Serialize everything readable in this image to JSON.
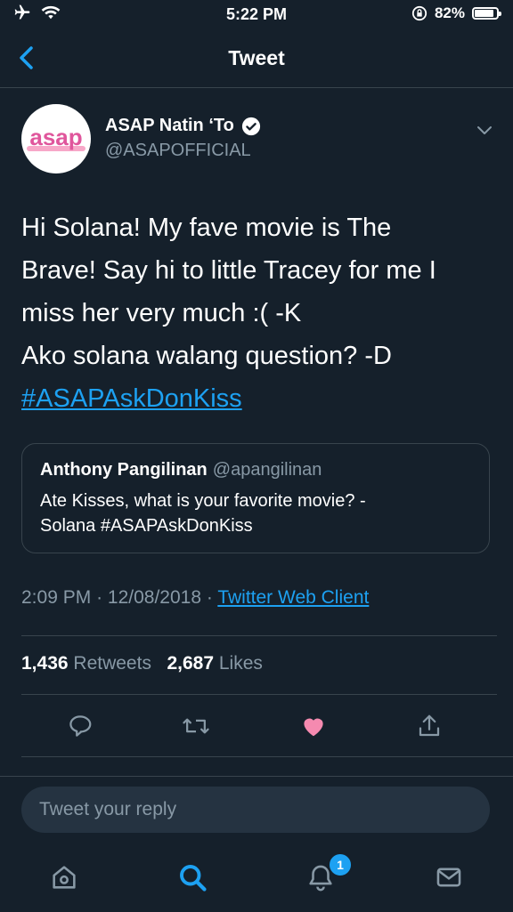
{
  "status_bar": {
    "time": "5:22 PM",
    "battery": "82%",
    "battery_level": 0.82
  },
  "nav": {
    "title": "Tweet"
  },
  "author": {
    "name": "ASAP Natin ‘To",
    "handle": "@ASAPOFFICIAL",
    "avatar_text": "asap"
  },
  "tweet": {
    "lines": [
      "Hi Solana! My fave movie is The",
      "Brave! Say hi to little Tracey for me I",
      "miss her very much :( -K",
      "Ako solana walang question? -D"
    ],
    "hashtag": "#ASAPAskDonKiss"
  },
  "quote": {
    "name": "Anthony Pangilinan",
    "handle": "@apangilinan",
    "lines": [
      "Ate Kisses, what is your favorite movie? -",
      "Solana #ASAPAskDonKiss"
    ]
  },
  "meta": {
    "time": "2:09 PM",
    "sep": "·",
    "date": "12/08/2018",
    "client": "Twitter Web Client"
  },
  "stats": {
    "retweets": "1,436",
    "retweets_label": "Retweets",
    "likes": "2,687",
    "likes_label": "Likes"
  },
  "reply": {
    "placeholder": "Tweet your reply"
  },
  "tabbar": {
    "notifications_badge": "1"
  },
  "colors": {
    "background": "#15202b",
    "accent": "#1da1f2",
    "muted": "#8899a6",
    "like": "#e0245e"
  }
}
